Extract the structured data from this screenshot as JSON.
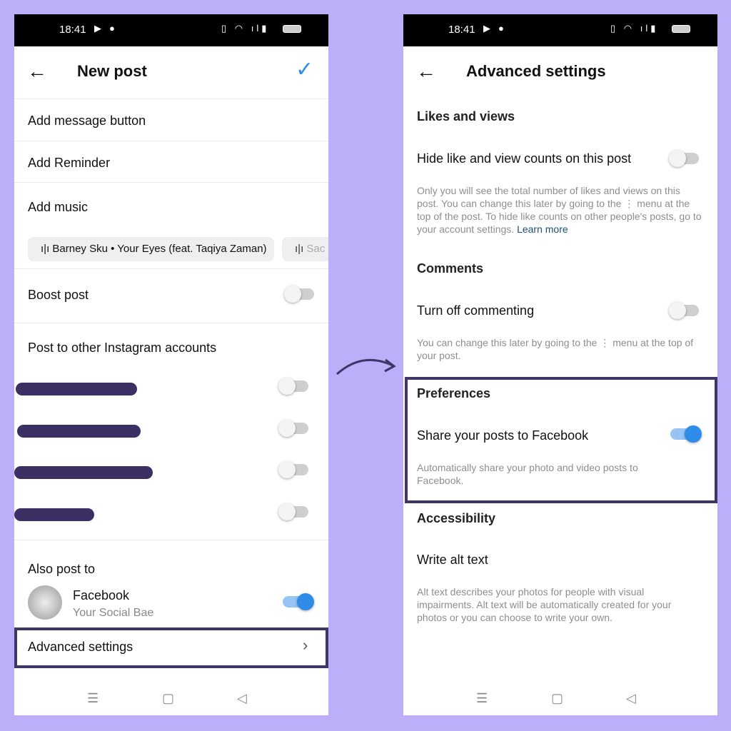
{
  "status_bar": {
    "time": "18:41",
    "left_icons": [
      "youtube-icon",
      "app-icon"
    ],
    "right_icons": [
      "vibrate-icon",
      "wifi-icon",
      "volte-icon",
      "signal-icon",
      "battery-icon"
    ]
  },
  "left": {
    "title": "New post",
    "items": [
      "Add message button",
      "Add Reminder",
      "Add music"
    ],
    "music_chips": [
      "Barney Sku • Your Eyes (feat. Taqiya Zaman)",
      "Sac"
    ],
    "boost": {
      "label": "Boost post",
      "on": false
    },
    "other_accounts": {
      "label": "Post to other Instagram accounts",
      "toggles": [
        false,
        false,
        false,
        false
      ]
    },
    "also_post": {
      "label": "Also post to",
      "platform": "Facebook",
      "account": "Your Social Bae",
      "on": true
    },
    "advanced": "Advanced settings"
  },
  "right": {
    "title": "Advanced settings",
    "likes": {
      "heading": "Likes and views",
      "label": "Hide like and view counts on this post",
      "on": false,
      "desc": "Only you will see the total number of likes and views on this post. You can change this later by going to the ⋮ menu at the top of the post. To hide like counts on other people's posts, go to your account settings.",
      "link": "Learn more"
    },
    "comments": {
      "heading": "Comments",
      "label": "Turn off commenting",
      "on": false,
      "desc": "You can change this later by going to the ⋮ menu at the top of your post."
    },
    "prefs": {
      "heading": "Preferences",
      "label": "Share your posts to Facebook",
      "on": true,
      "desc": "Automatically share your photo and video posts to Facebook."
    },
    "access": {
      "heading": "Accessibility",
      "label": "Write alt text",
      "desc": "Alt text describes your photos for people with visual impairments. Alt text will be automatically created for your photos or you can choose to write your own."
    }
  },
  "nav_icons": [
    "menu-icon",
    "home-icon",
    "back-icon"
  ],
  "colors": {
    "background": "#bdaefa",
    "accent": "#2f8ce8",
    "highlight": "#3f3566"
  }
}
